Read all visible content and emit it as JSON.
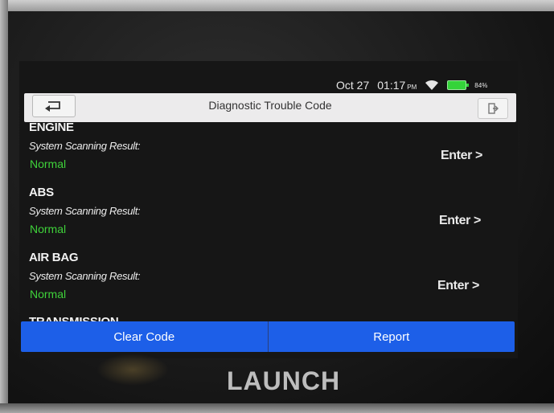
{
  "status_bar": {
    "date": "Oct 27",
    "time": "01:17",
    "ampm": "PM",
    "battery_pct": "84%",
    "battery_color": "#34d33a"
  },
  "header": {
    "title": "Diagnostic Trouble Code",
    "back_icon": "return-arrow-icon",
    "exit_icon": "exit-door-icon"
  },
  "systems": [
    {
      "name": "ENGINE",
      "result_label": "System Scanning Result:",
      "status": "Normal",
      "enter_label": "Enter >"
    },
    {
      "name": "ABS",
      "result_label": "System Scanning Result:",
      "status": "Normal",
      "enter_label": "Enter >"
    },
    {
      "name": "AIR BAG",
      "result_label": "System Scanning Result:",
      "status": "Normal",
      "enter_label": "Enter >"
    },
    {
      "name": "TRANSMISSION"
    }
  ],
  "footer": {
    "clear_code_label": "Clear Code",
    "report_label": "Report",
    "accent_color": "#1d5fe8"
  },
  "brand": "LAUNCH",
  "colors": {
    "normal_status": "#3fd23a",
    "title_bar": "#ecebec"
  }
}
